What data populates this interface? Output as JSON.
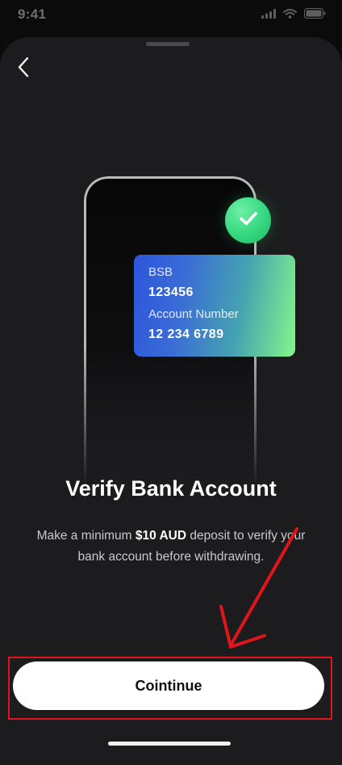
{
  "status_bar": {
    "time": "9:41",
    "icons": [
      "signal-icon",
      "wifi-icon",
      "battery-icon"
    ]
  },
  "nav": {
    "back_icon": "chevron-left-icon"
  },
  "card": {
    "bsb_label": "BSB",
    "bsb_value": "123456",
    "account_label": "Account Number",
    "account_value": "12 234 6789",
    "badge_icon": "checkmark-icon"
  },
  "title": "Verify Bank Account",
  "description": {
    "before": "Make a minimum ",
    "amount": "$10 AUD",
    "after": " deposit to verify your bank account before withdrawing."
  },
  "button": {
    "label": "Cointinue"
  },
  "annotation": {
    "color": "#e0151c"
  },
  "colors": {
    "sheet_bg": "#1c1c1e",
    "badge_green": "#34d77f",
    "card_gradient_start": "#2d55dc",
    "card_gradient_end": "#84f58a"
  }
}
